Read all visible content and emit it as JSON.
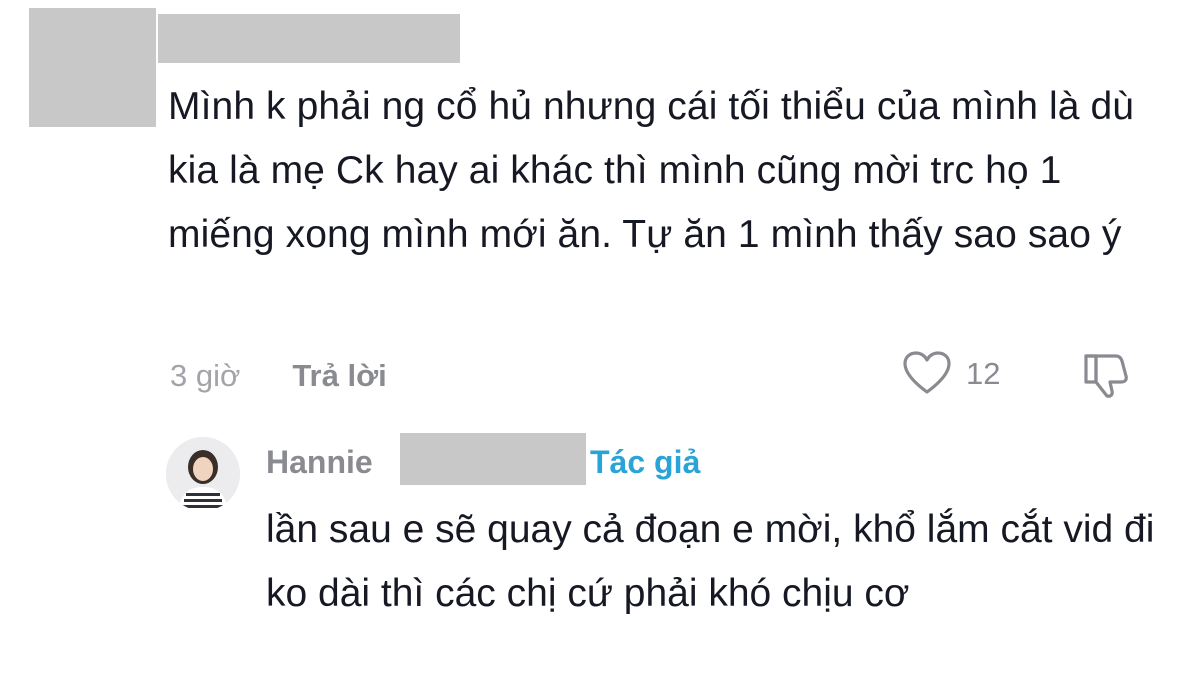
{
  "comment": {
    "text": "Mình k phải ng cổ hủ nhưng cái tối thiểu của mình là dù kia là mẹ Ck hay ai khác thì mình cũng mời trc họ 1 miếng xong mình mới ăn. Tự ăn 1 mình thấy sao sao ý",
    "timestamp": "3 giờ",
    "reply_label": "Trả lời",
    "like_count": "12",
    "like_icon": "heart-outline-icon",
    "dislike_icon": "thumbs-down-icon"
  },
  "reply": {
    "author_name": "Hannie",
    "author_badge": "Tác giả",
    "text": "lần sau e sẽ quay cả đoạn e mời, khổ lắm cắt vid đi ko dài thì các chị cứ phải khó chịu cơ"
  },
  "colors": {
    "text_primary": "#161823",
    "text_secondary": "#8a8b91",
    "author_badge": "#2aa3d7",
    "redaction": "#c8c8c8"
  }
}
